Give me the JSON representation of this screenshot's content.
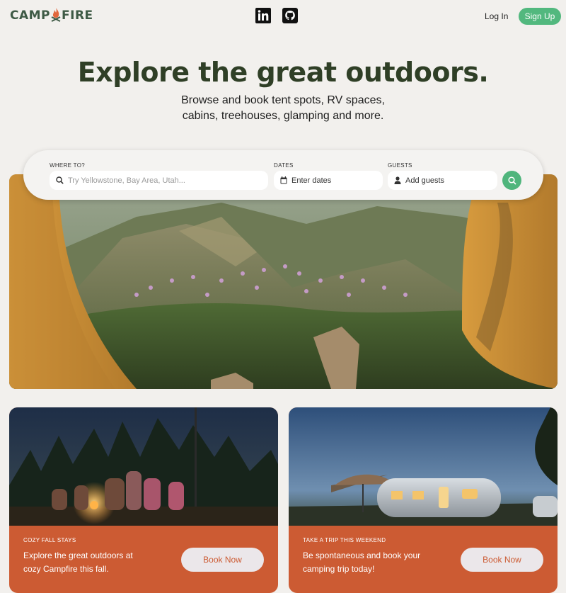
{
  "header": {
    "logo_text_left": "CAMP",
    "logo_text_right": "FIRE",
    "login_label": "Log In",
    "signup_label": "Sign Up",
    "social": [
      "linkedin-icon",
      "github-icon"
    ]
  },
  "hero": {
    "title": "Explore the great outdoors.",
    "subtitle": "Browse and book tent spots, RV spaces, cabins, treehouses, glamping and more."
  },
  "search": {
    "where_label": "WHERE TO?",
    "where_placeholder": "Try Yellowstone, Bay Area, Utah...",
    "dates_label": "DATES",
    "dates_text": "Enter dates",
    "guests_label": "GUESTS",
    "guests_text": "Add guests"
  },
  "cards": [
    {
      "eyebrow": "COZY FALL STAYS",
      "description": "Explore the great outdoors at cozy Campfire this fall.",
      "button": "Book Now"
    },
    {
      "eyebrow": "TAKE A TRIP THIS WEEKEND",
      "description": "Be spontaneous and book your camping trip today!",
      "button": "Book Now"
    }
  ],
  "colors": {
    "brand_green": "#3e5a45",
    "accent_green": "#52b87e",
    "card_orange": "#cc5b33",
    "background": "#f2f0ed"
  }
}
